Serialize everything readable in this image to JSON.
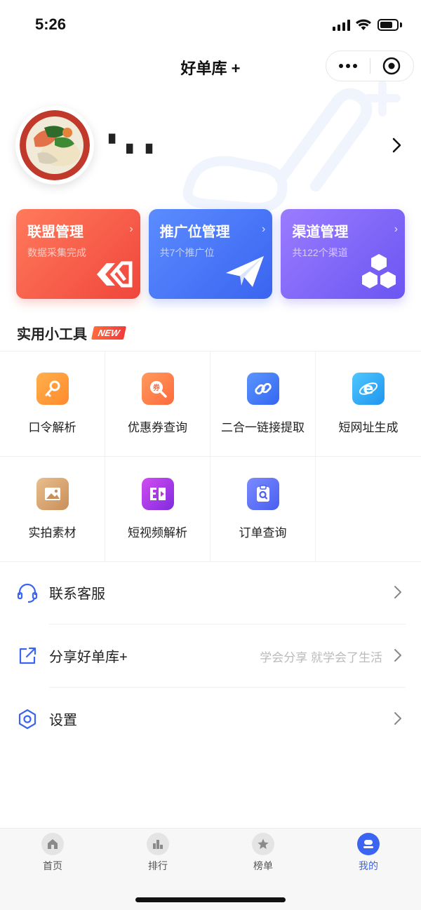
{
  "status_bar": {
    "time": "5:26",
    "battery_level": 0.75
  },
  "header": {
    "title": "好单库 +"
  },
  "profile": {
    "username": "▘ ▖▗"
  },
  "cards": [
    {
      "title": "联盟管理",
      "subtitle": "数据采集完成",
      "icon": "link-logo-icon",
      "color": "#f0463b"
    },
    {
      "title": "推广位管理",
      "subtitle": "共7个推广位",
      "icon": "paper-plane-icon",
      "color": "#3a64f0"
    },
    {
      "title": "渠道管理",
      "subtitle": "共122个渠道",
      "icon": "hexagons-icon",
      "color": "#6b55f2"
    }
  ],
  "tools": {
    "title": "实用小工具",
    "badge": "NEW",
    "items": [
      {
        "label": "口令解析",
        "icon": "key-icon",
        "color": "#ff9a3c"
      },
      {
        "label": "优惠券查询",
        "icon": "coupon-search-icon",
        "color": "#ff7a4a"
      },
      {
        "label": "二合一链接提取",
        "icon": "link-icon",
        "color": "#3d7cf5"
      },
      {
        "label": "短网址生成",
        "icon": "browser-e-icon",
        "color": "#2aa8f2"
      },
      {
        "label": "实拍素材",
        "icon": "image-icon",
        "color": "#d9a772"
      },
      {
        "label": "短视频解析",
        "icon": "video-icon",
        "color": "#b43be0"
      },
      {
        "label": "订单查询",
        "icon": "order-search-icon",
        "color": "#5a6cf0"
      }
    ]
  },
  "menu": [
    {
      "label": "联系客服",
      "hint": "",
      "icon": "headset-icon"
    },
    {
      "label": "分享好单库+",
      "hint": "学会分享 就学会了生活",
      "icon": "share-icon"
    },
    {
      "label": "设置",
      "hint": "",
      "icon": "settings-icon"
    }
  ],
  "tabbar": [
    {
      "label": "首页",
      "icon": "home-icon",
      "active": false
    },
    {
      "label": "排行",
      "icon": "ranking-icon",
      "active": false
    },
    {
      "label": "榜单",
      "icon": "star-icon",
      "active": false
    },
    {
      "label": "我的",
      "icon": "profile-icon",
      "active": true
    }
  ]
}
